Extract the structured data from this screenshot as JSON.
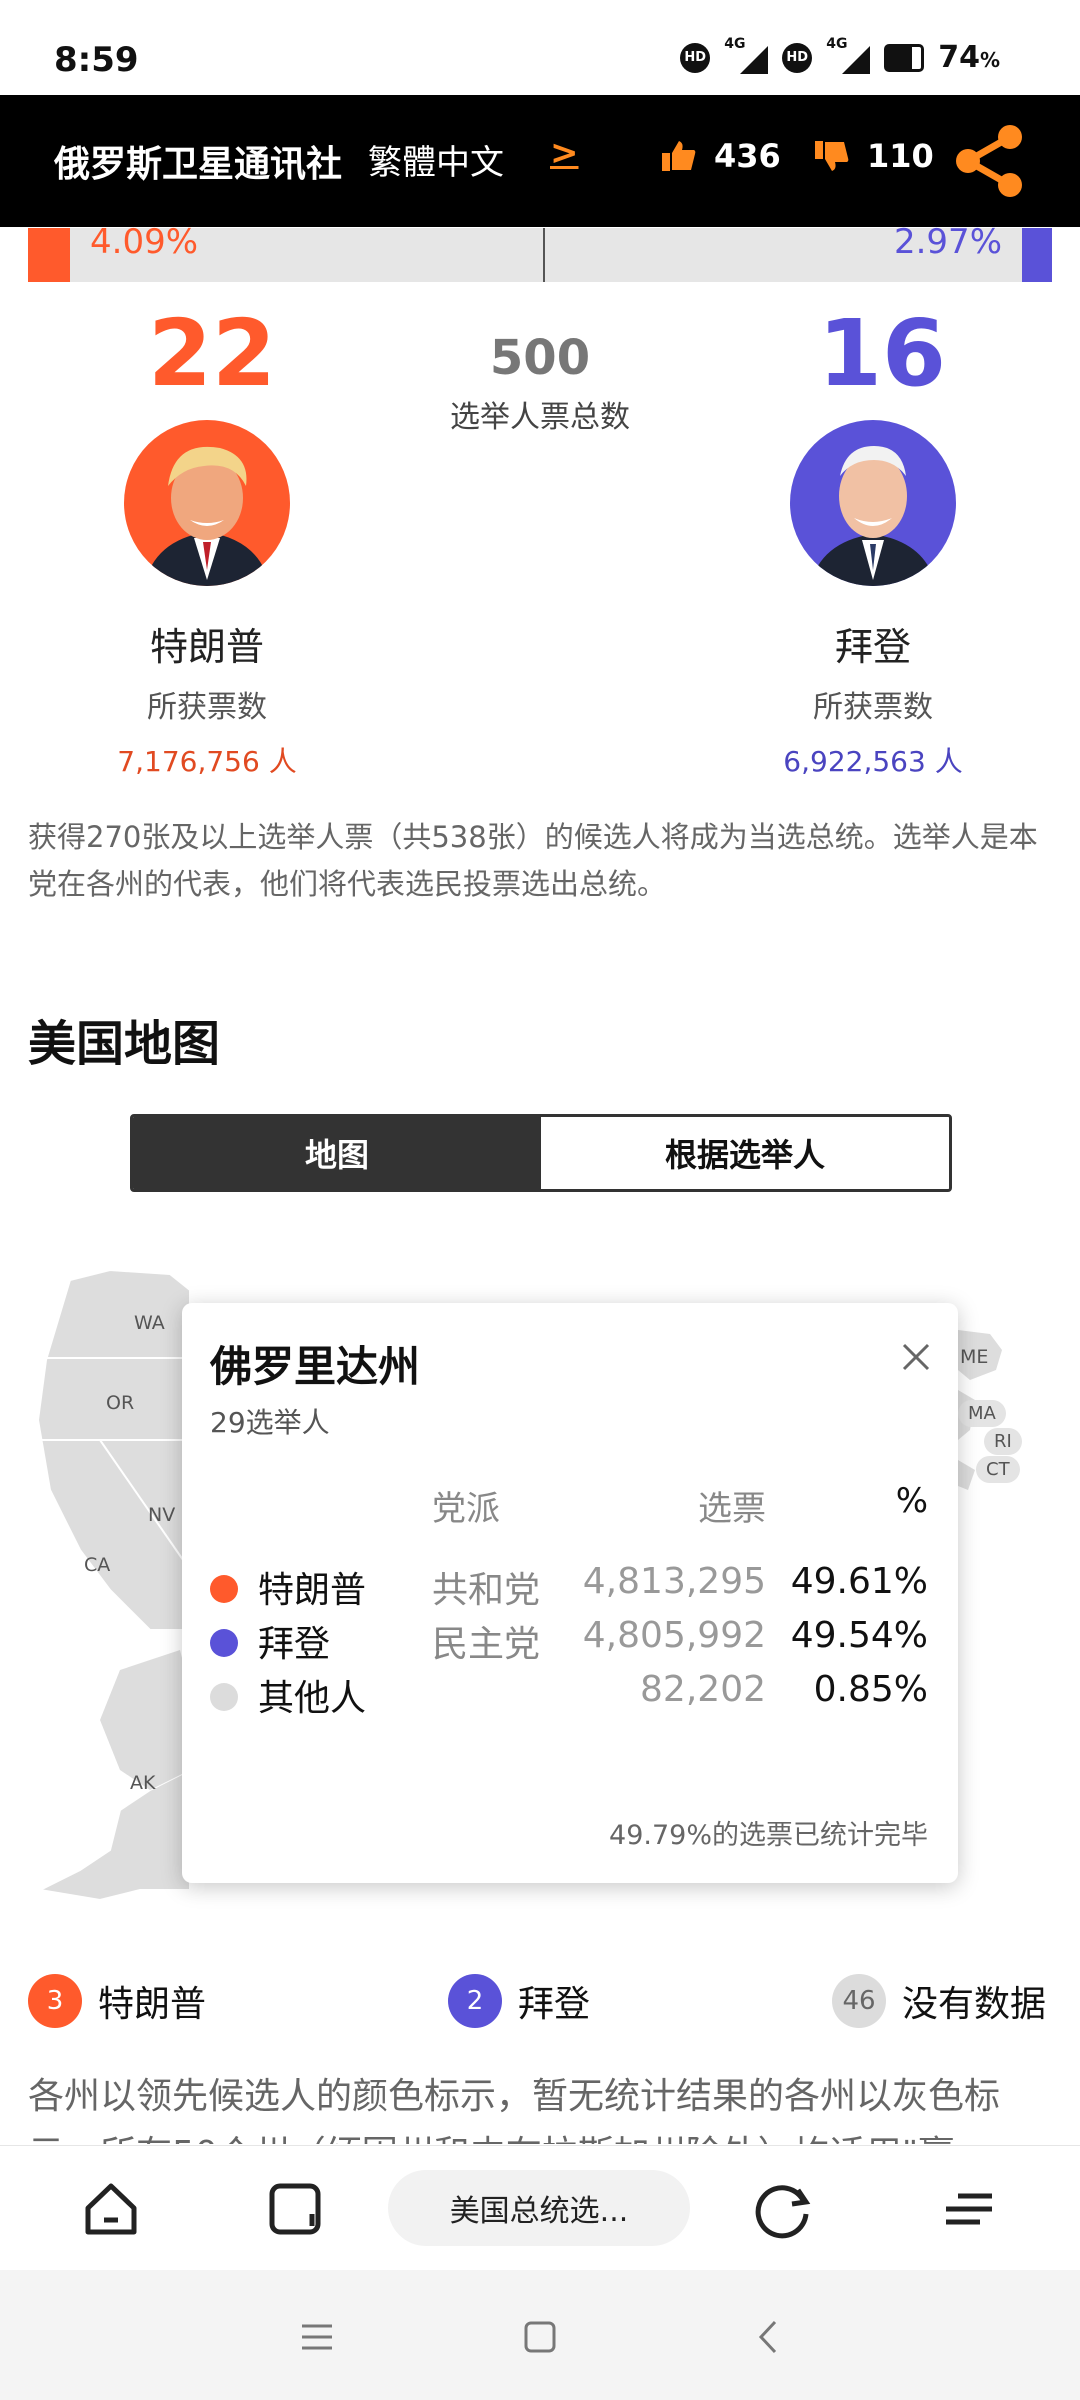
{
  "status": {
    "time": "8:59",
    "hd1": "HD",
    "net1": "4G",
    "hd2": "HD",
    "net2": "4G",
    "battery": "74",
    "battery_unit": "%",
    "battery_level": 0.74
  },
  "header": {
    "brand": "俄罗斯卫星通讯社",
    "language": "繁體中文",
    "lang_arrow": ">",
    "likes": "436",
    "dislikes": "110",
    "accent": "#ff8a1f"
  },
  "bar": {
    "left_pct": "4.09%",
    "right_pct": "2.97%",
    "left_share": 0.0409,
    "right_share": 0.0297
  },
  "candidates": {
    "trump": {
      "electors": "22",
      "name": "特朗普",
      "sub": "所获票数",
      "votes": "7,176,756 人",
      "color": "#ff5a2c"
    },
    "biden": {
      "electors": "16",
      "name": "拜登",
      "sub": "所获票数",
      "votes": "6,922,563 人",
      "color": "#5a52d8"
    },
    "total": {
      "num": "500",
      "label": "选举人票总数"
    }
  },
  "intro_text": "获得270张及以上选举人票（共538张）的候选人将成为当选总统。选举人是本党在各州的代表，他们将代表选民投票选出总统。",
  "section_title": "美国地图",
  "tabs": {
    "map": "地图",
    "by_electors": "根据选举人"
  },
  "map_labels": {
    "wa": "WA",
    "or": "OR",
    "nv": "NV",
    "ca": "CA",
    "ak": "AK",
    "me": "ME",
    "ma": "MA",
    "ri": "RI",
    "ct": "CT"
  },
  "popup": {
    "title": "佛罗里达州",
    "electors": "29选举人",
    "col_party": "党派",
    "col_votes": "选票",
    "col_pct": "%",
    "rows": [
      {
        "name": "特朗普",
        "party": "共和党",
        "votes": "4,813,295",
        "pct": "49.61%",
        "color": "#ff5a2c"
      },
      {
        "name": "拜登",
        "party": "民主党",
        "votes": "4,805,992",
        "pct": "49.54%",
        "color": "#5a52d8"
      },
      {
        "name": "其他人",
        "party": "",
        "votes": "82,202",
        "pct": "0.85%",
        "color": "#dcdcdc"
      }
    ],
    "footnote": "49.79%的选票已统计完毕"
  },
  "legend": [
    {
      "count": "3",
      "label": "特朗普",
      "color": "#ff5a2c"
    },
    {
      "count": "2",
      "label": "拜登",
      "color": "#5a52d8"
    },
    {
      "count": "46",
      "label": "没有数据",
      "color": "#dcdcdc"
    }
  ],
  "map_note": "各州以领先候选人的颜色标示，暂无统计结果的各州以灰色标示。所有50个州（缅因州和内布拉斯加州除外）均适用\"赢",
  "browser": {
    "url": "美国总统选..."
  }
}
